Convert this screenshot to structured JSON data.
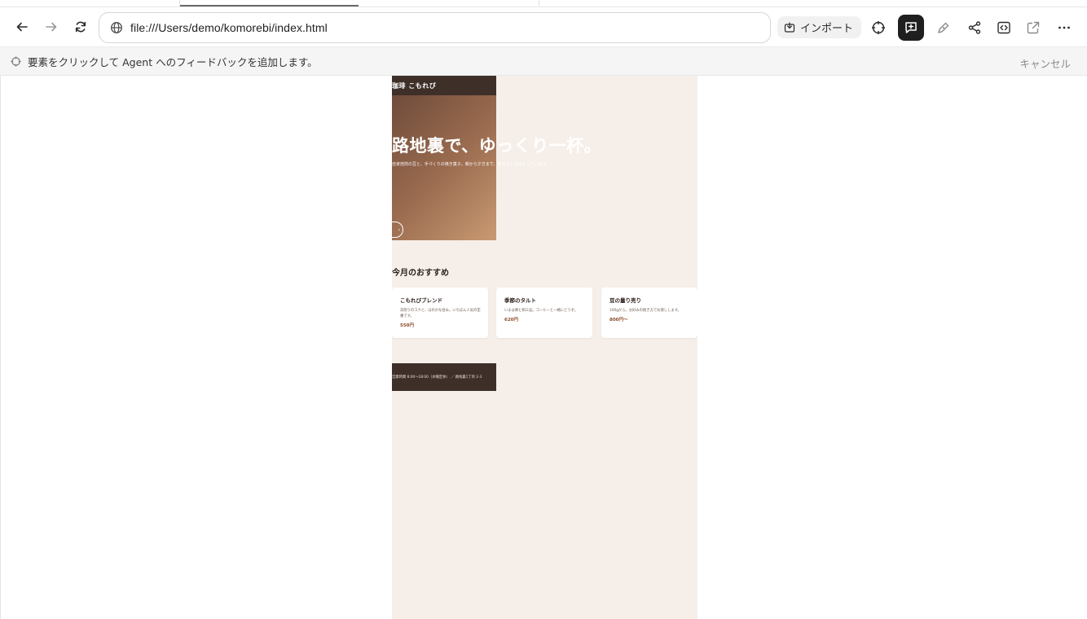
{
  "browser": {
    "url": "file:///Users/demo/komorebi/index.html",
    "import_label": "インポート",
    "icons": {
      "back": "arrow-left-icon",
      "forward": "arrow-right-icon",
      "reload": "reload-icon",
      "globe": "globe-icon",
      "import": "import-icon",
      "crosshair": "crosshair-icon",
      "feedback": "comment-plus-icon",
      "pen": "pen-icon",
      "share": "share-icon",
      "code": "code-icon",
      "external": "external-link-icon",
      "more": "more-horizontal-icon"
    }
  },
  "feedback_bar": {
    "message": "要素をクリックして Agent へのフィードバックを追加します。",
    "cancel_label": "キャンセル"
  },
  "site": {
    "logo": "珈琲 こもれび",
    "hero": {
      "title": "路地裏で、ゆっくり一杯。",
      "subtitle": "自家焙煎の豆と、手づくりの焼き菓子。朝から夕方まで、ゆるりとお待ちしています。",
      "button": "›"
    },
    "section_title": "今月のおすすめ",
    "cards": [
      {
        "name": "こもれびブレンド",
        "desc": "深煎りのコクと、ほのかな甘み。いちばん人気の定番です。",
        "price": "550円"
      },
      {
        "name": "季節のタルト",
        "desc": "いまは栗と和三盆。コーヒーと一緒にどうぞ。",
        "price": "620円"
      },
      {
        "name": "豆の量り売り",
        "desc": "100gから。お好みの挽き方でお渡しします。",
        "price": "800円〜"
      }
    ],
    "footer": "営業時間 8:00〜18:00（水曜定休） ／ 路地裏1丁目 2-3"
  },
  "colors": {
    "site_bg": "#f6efe9",
    "header_bg": "#3e2f29",
    "accent_price": "#8a4a2a",
    "active_tool": "#1f1f1f"
  }
}
